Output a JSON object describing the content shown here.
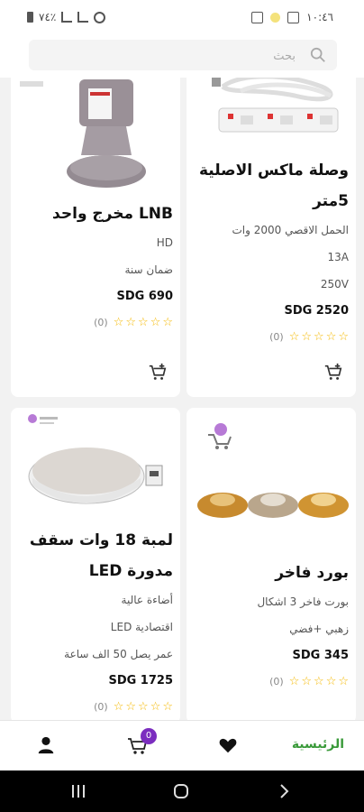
{
  "status_bar": {
    "time": "١٠:٤٦",
    "battery": "٧٤٪"
  },
  "search": {
    "placeholder": "بحث"
  },
  "products": [
    {
      "title": "وصلة ماكس الاصلية 5متر",
      "specs": [
        "الحمل الاقصي 2000 وات",
        "13A",
        "250V"
      ],
      "price": "SDG 2520",
      "rating_count": "(0)",
      "image_icon": "power-strip-image"
    },
    {
      "title": "LNB مخرج واحد",
      "specs": [
        "HD",
        "ضمان سنة"
      ],
      "price": "SDG 690",
      "rating_count": "(0)",
      "image_icon": "lnb-image"
    },
    {
      "title": "بورد فاخر",
      "specs": [
        "بورت فاخر 3 اشكال",
        "زهبي +فضي"
      ],
      "price": "SDG 345",
      "rating_count": "(0)",
      "image_icon": "ceiling-rose-image"
    },
    {
      "title": "لمبة 18 وات سقف مدورة LED",
      "specs": [
        "أضاءة عالية",
        "اقتصادية LED",
        "عمر يصل 50 الف ساعة"
      ],
      "price": "SDG 1725",
      "rating_count": "(0)",
      "image_icon": "led-panel-image"
    }
  ],
  "bottom_nav": {
    "home_label": "الرئيسية",
    "cart_badge": "0"
  },
  "colors": {
    "accent_green": "#3a9a3a",
    "badge_purple": "#7b2dbf",
    "star_yellow": "#f5b800"
  }
}
